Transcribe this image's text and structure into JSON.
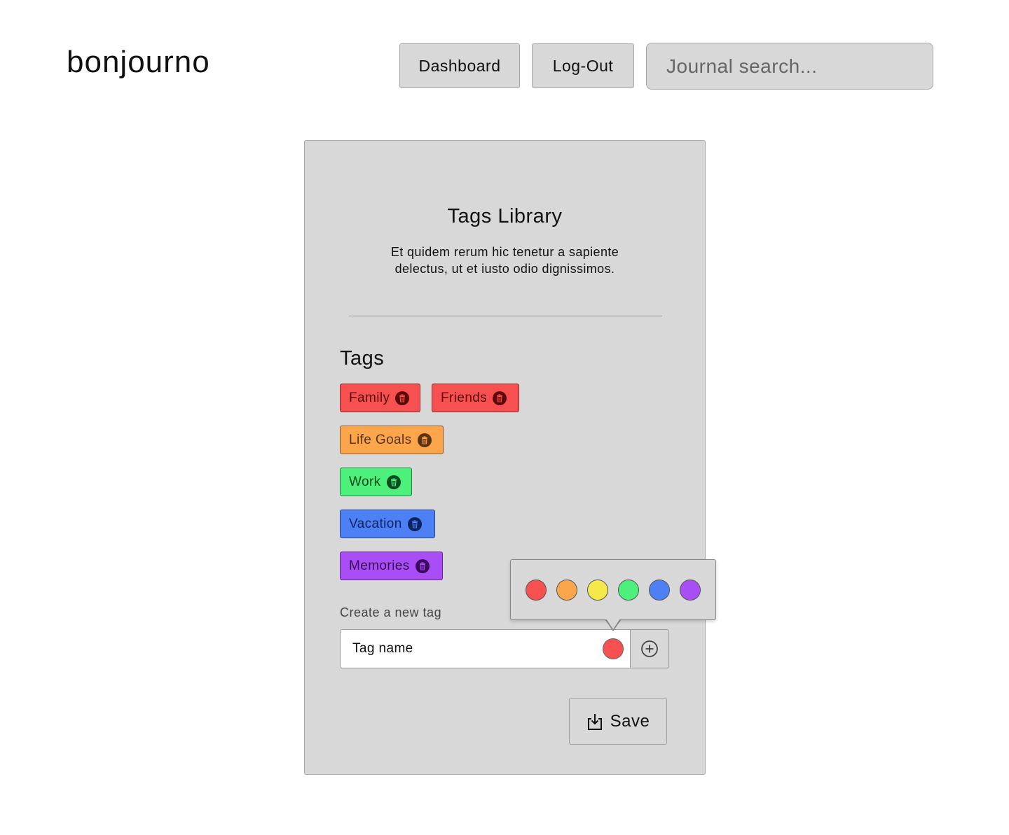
{
  "header": {
    "logo": "bonjourno",
    "dashboard_label": "Dashboard",
    "logout_label": "Log-Out",
    "search_placeholder": "Journal search..."
  },
  "card": {
    "title": "Tags Library",
    "description": "Et quidem rerum hic tenetur a sapiente delectus, ut et iusto odio dignissimos.",
    "tags_heading": "Tags",
    "tags": [
      {
        "label": "Family",
        "color": "#f75050",
        "icon": "trash-icon"
      },
      {
        "label": "Friends",
        "color": "#f75050",
        "icon": "trash-icon"
      },
      {
        "label": "Life Goals",
        "color": "#fba64c",
        "icon": "trash-icon"
      },
      {
        "label": "Work",
        "color": "#4cf07a",
        "icon": "trash-icon"
      },
      {
        "label": "Vacation",
        "color": "#4d7ff5",
        "icon": "trash-icon"
      },
      {
        "label": "Memories",
        "color": "#a94ef5",
        "icon": "trash-icon"
      }
    ],
    "create_label": "Create a new tag",
    "tag_name_placeholder": "Tag name",
    "selected_color": "#f75050",
    "add_icon": "plus-circle-icon",
    "save_label": "Save",
    "save_icon": "download-icon"
  },
  "color_picker": {
    "swatches": [
      "#f75050",
      "#fba64c",
      "#f5e94a",
      "#4cf07a",
      "#4d7ff5",
      "#a94ef5"
    ]
  }
}
